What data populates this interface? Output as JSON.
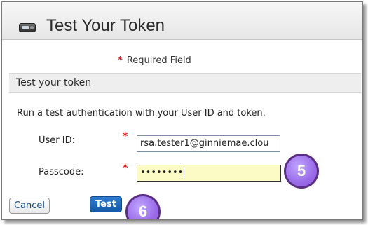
{
  "dialog": {
    "title": "Test Your Token",
    "icon": "rsa-token-icon"
  },
  "form": {
    "required_note": "Required Field",
    "required_mark": "*",
    "section_title": "Test your token",
    "instructions": "Run a test authentication with your User ID and token.",
    "user_id_label": "User ID:",
    "user_id_value": "rsa.tester1@ginniemae.clou",
    "passcode_label": "Passcode:",
    "passcode_value": "••••••••"
  },
  "buttons": {
    "cancel_label": "Cancel",
    "test_label": "Test"
  },
  "callouts": {
    "step5": "5",
    "step6": "6"
  },
  "colors": {
    "required_star": "#d61b1b",
    "callout_fill": "#9a6be8",
    "callout_border": "#5a2e82",
    "test_button": "#1559a8",
    "passcode_highlight": "#fdfbc5"
  }
}
